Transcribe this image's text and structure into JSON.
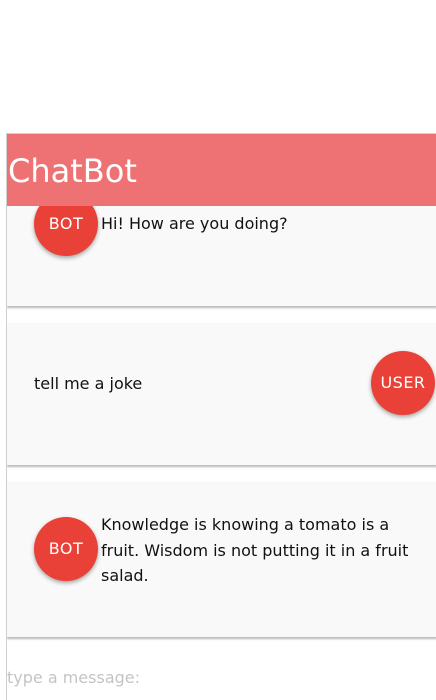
{
  "header": {
    "title": "ChatBot",
    "color": "#ee7274"
  },
  "messages": [
    {
      "sender": "BOT",
      "text": "Hi! How are you doing?"
    },
    {
      "sender": "USER",
      "text": "tell me a joke"
    },
    {
      "sender": "BOT",
      "text": "Knowledge is knowing a tomato is a fruit. Wisdom is not putting it in a fruit salad."
    }
  ],
  "input": {
    "value": "",
    "placeholder": "type a message:"
  },
  "colors": {
    "avatar": "#e94137",
    "card_background": "#f9f9f9"
  }
}
